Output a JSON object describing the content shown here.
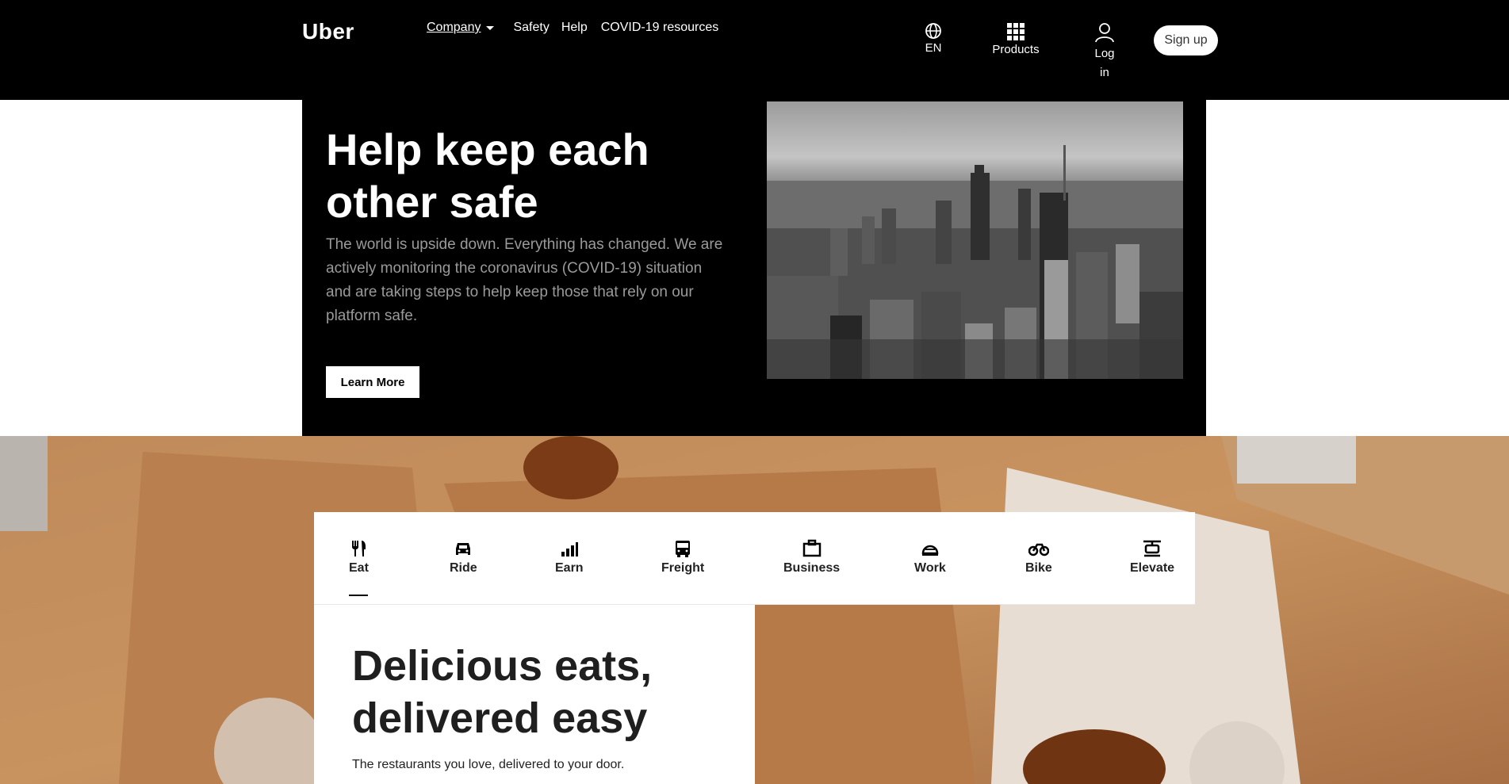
{
  "header": {
    "logo": "Uber",
    "nav": {
      "company": "Company",
      "safety": "Safety",
      "help": "Help",
      "covid": "COVID-19 resources"
    },
    "language": "EN",
    "products": "Products",
    "login_line1": "Log",
    "login_line2": "in",
    "signup": "Sign up"
  },
  "hero": {
    "title": "Help keep each other safe",
    "text": "The world is upside down. Everything has changed. We are actively monitoring the coronavirus (COVID-19) situation and are taking steps to help keep those that rely on our platform safe.",
    "button": "Learn More"
  },
  "tabs": [
    {
      "label": "Eat",
      "icon": "fork-knife-icon"
    },
    {
      "label": "Ride",
      "icon": "car-icon"
    },
    {
      "label": "Earn",
      "icon": "bars-icon"
    },
    {
      "label": "Freight",
      "icon": "truck-icon"
    },
    {
      "label": "Business",
      "icon": "briefcase-icon"
    },
    {
      "label": "Work",
      "icon": "hardhat-icon"
    },
    {
      "label": "Bike",
      "icon": "bike-icon"
    },
    {
      "label": "Elevate",
      "icon": "elevate-icon"
    }
  ],
  "eats": {
    "title": "Delicious eats, delivered easy",
    "subtitle": "The restaurants you love, delivered to your door."
  },
  "colors": {
    "header_bg": "#000000",
    "hero_bg": "#000000",
    "food_tone": "#b97d4d"
  }
}
